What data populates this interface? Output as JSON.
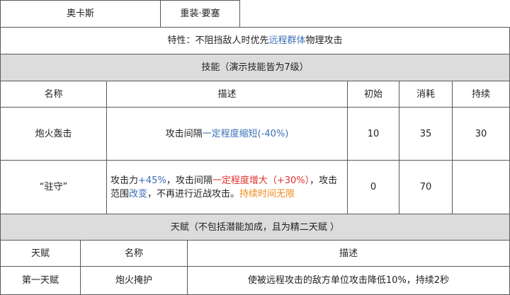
{
  "operator": {
    "name": "奥卡斯",
    "class": "重装·要塞"
  },
  "trait": {
    "prefix": "特性：不阻挡敌人时优先",
    "highlight": "远程群体",
    "suffix": "物理攻击"
  },
  "skills_section": {
    "title": "技能（演示技能皆为7级）"
  },
  "skills_table": {
    "headers": {
      "name": "名称",
      "desc": "描述",
      "initial": "初始",
      "cost": "消耗",
      "duration": "持续"
    },
    "rows": [
      {
        "name": "炮火轰击",
        "desc_prefix": "攻击间隔",
        "desc_highlight": "一定程度缩短(-40%)",
        "initial": "10",
        "cost": "35",
        "duration": "30"
      },
      {
        "name": "“驻守”",
        "desc_p1": "攻击力",
        "desc_p2": "+45%",
        "desc_p3": "，攻击间隔",
        "desc_p4": "一定程度增大（+30%）",
        "desc_p5": "，攻击范围",
        "desc_p6": "改变",
        "desc_p7": "，不再进行近战攻击。",
        "desc_p8": "持续时间无限",
        "initial": "0",
        "cost": "70",
        "duration": ""
      }
    ]
  },
  "talents_section": {
    "title": "天赋（不包括潜能加成，且为精二天赋 ）"
  },
  "talents_table": {
    "headers": {
      "talent": "天赋",
      "name": "名称",
      "desc": "描述"
    },
    "rows": [
      {
        "talent": "第一天赋",
        "name": "炮火掩护",
        "desc": "使被远程攻击的敌方单位攻击降低10%，持续2秒"
      }
    ]
  },
  "colors": {
    "highlight_blue": "#3b6fb6",
    "highlight_red": "#e0302a",
    "highlight_orange": "#f08a1c",
    "section_bg": "#dcdcdc",
    "border": "#5a5a5a"
  }
}
